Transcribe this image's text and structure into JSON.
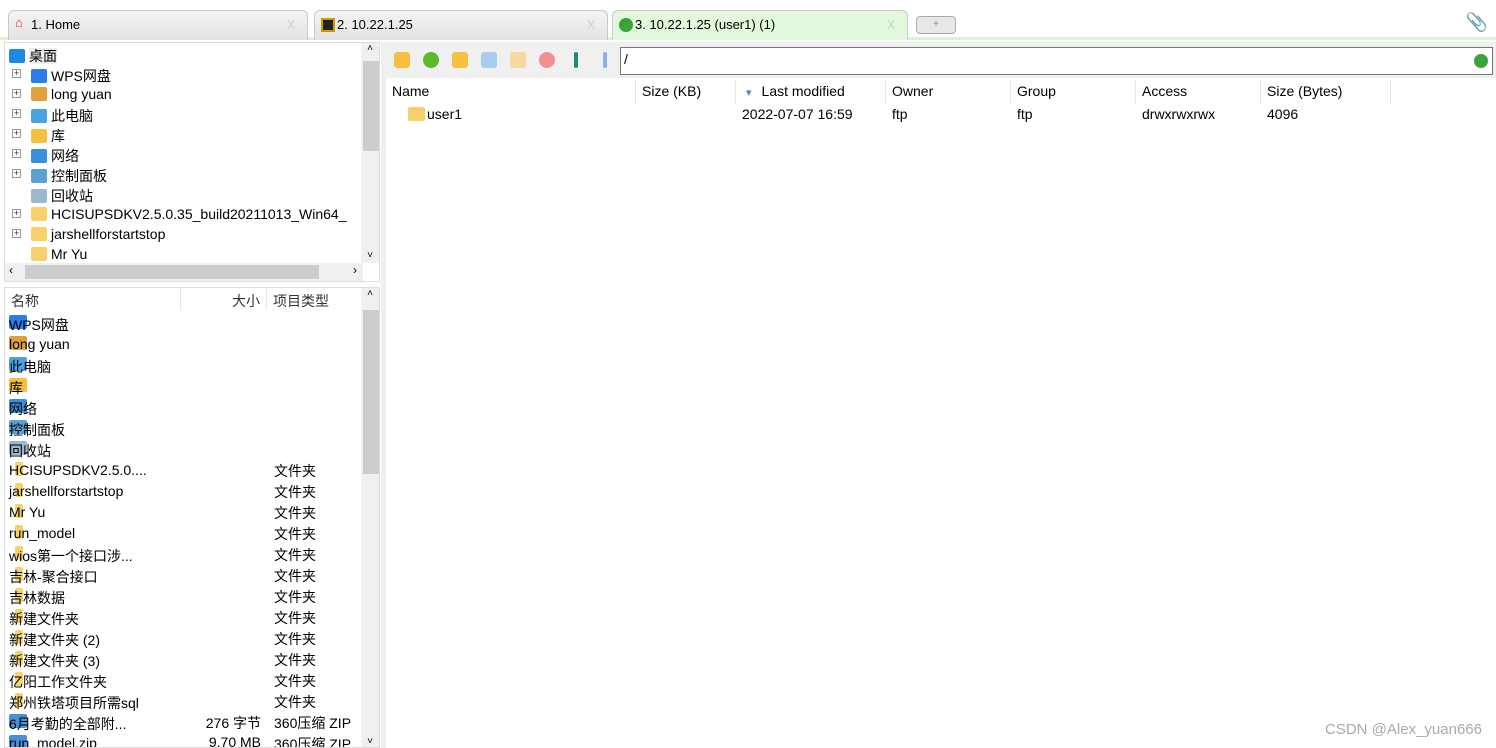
{
  "tabs": [
    {
      "label": "1. Home",
      "icon": "home-icon"
    },
    {
      "label": "2. 10.22.1.25",
      "icon": "terminal-icon"
    },
    {
      "label": "3. 10.22.1.25 (user1) (1)",
      "icon": "globe-icon",
      "active": true
    }
  ],
  "tab_close": "X",
  "tree": [
    {
      "label": "桌面",
      "expand": false,
      "color": "#1e88e5"
    },
    {
      "label": "WPS网盘",
      "expand": true,
      "color": "#2b7de9"
    },
    {
      "label": "long yuan",
      "expand": true,
      "color": "#e0a040"
    },
    {
      "label": "此电脑",
      "expand": true,
      "color": "#4aa3e0"
    },
    {
      "label": "库",
      "expand": true,
      "color": "#f5c040"
    },
    {
      "label": "网络",
      "expand": true,
      "color": "#3a8fd8"
    },
    {
      "label": "控制面板",
      "expand": true,
      "color": "#5aa0d0"
    },
    {
      "label": "回收站",
      "expand": false,
      "color": "#9bb8d0"
    },
    {
      "label": "HCISUPSDKV2.5.0.35_build20211013_Win64_",
      "expand": true,
      "color": "#f5d36a"
    },
    {
      "label": "jarshellforstartstop",
      "expand": true,
      "color": "#f5d36a"
    },
    {
      "label": "Mr Yu",
      "expand": false,
      "color": "#f5d36a"
    }
  ],
  "list_headers": {
    "name": "名称",
    "size": "大小",
    "type": "项目类型"
  },
  "list": [
    {
      "name": "WPS网盘",
      "size": "",
      "type": "",
      "color": "#2b7de9"
    },
    {
      "name": "long yuan",
      "size": "",
      "type": "",
      "color": "#e0a040"
    },
    {
      "name": "此电脑",
      "size": "",
      "type": "",
      "color": "#4aa3e0"
    },
    {
      "name": "库",
      "size": "",
      "type": "",
      "color": "#f5c040"
    },
    {
      "name": "网络",
      "size": "",
      "type": "",
      "color": "#3a8fd8"
    },
    {
      "name": "控制面板",
      "size": "",
      "type": "",
      "color": "#5aa0d0"
    },
    {
      "name": "回收站",
      "size": "",
      "type": "",
      "color": "#9bb8d0"
    },
    {
      "name": "HCISUPSDKV2.5.0....",
      "size": "",
      "type": "文件夹",
      "color": "#f5d36a"
    },
    {
      "name": "jarshellforstartstop",
      "size": "",
      "type": "文件夹",
      "color": "#f5d36a"
    },
    {
      "name": "Mr Yu",
      "size": "",
      "type": "文件夹",
      "color": "#f5d36a"
    },
    {
      "name": "run_model",
      "size": "",
      "type": "文件夹",
      "color": "#f5d36a"
    },
    {
      "name": "wios第一个接口涉...",
      "size": "",
      "type": "文件夹",
      "color": "#f5d36a"
    },
    {
      "name": "吉林-聚合接口",
      "size": "",
      "type": "文件夹",
      "color": "#f5d36a"
    },
    {
      "name": "吉林数据",
      "size": "",
      "type": "文件夹",
      "color": "#f5d36a"
    },
    {
      "name": "新建文件夹",
      "size": "",
      "type": "文件夹",
      "color": "#f5d36a"
    },
    {
      "name": "新建文件夹 (2)",
      "size": "",
      "type": "文件夹",
      "color": "#f5d36a"
    },
    {
      "name": "新建文件夹 (3)",
      "size": "",
      "type": "文件夹",
      "color": "#f5d36a"
    },
    {
      "name": "亿阳工作文件夹",
      "size": "",
      "type": "文件夹",
      "color": "#f5d36a"
    },
    {
      "name": "郑州铁塔项目所需sql",
      "size": "",
      "type": "文件夹",
      "color": "#f5d36a"
    },
    {
      "name": "6月考勤的全部附...",
      "size": "276 字节",
      "type": "360压缩 ZIP",
      "color": "#4a90d9"
    },
    {
      "name": "run_model.zip",
      "size": "9.70 MB",
      "type": "360压缩 ZIP",
      "color": "#4a90d9"
    }
  ],
  "toolbar": [
    {
      "icon": "parent-folder-icon",
      "color": "#f5c040"
    },
    {
      "icon": "refresh-icon",
      "color": "#5cb82c"
    },
    {
      "icon": "new-folder-icon",
      "color": "#f5c040"
    },
    {
      "icon": "new-file-icon",
      "color": "#a8cdf0"
    },
    {
      "icon": "folder-icon",
      "color": "#f7d9a0"
    },
    {
      "icon": "delete-icon",
      "color": "#f09090"
    },
    {
      "icon": "upload-icon",
      "color": "#1a8a7a"
    },
    {
      "icon": "download-icon",
      "color": "#90b0e0"
    }
  ],
  "address": "/",
  "columns": [
    "Name",
    "Size (KB)",
    "Last modified",
    "Owner",
    "Group",
    "Access",
    "Size (Bytes)"
  ],
  "sort_indicator": "▾",
  "files": [
    {
      "name": "user1",
      "size_kb": "",
      "modified": "2022-07-07 16:59",
      "owner": "ftp",
      "group": "ftp",
      "access": "drwxrwxrwx",
      "size_bytes": "4096"
    }
  ],
  "watermark": "CSDN @Alex_yuan666"
}
